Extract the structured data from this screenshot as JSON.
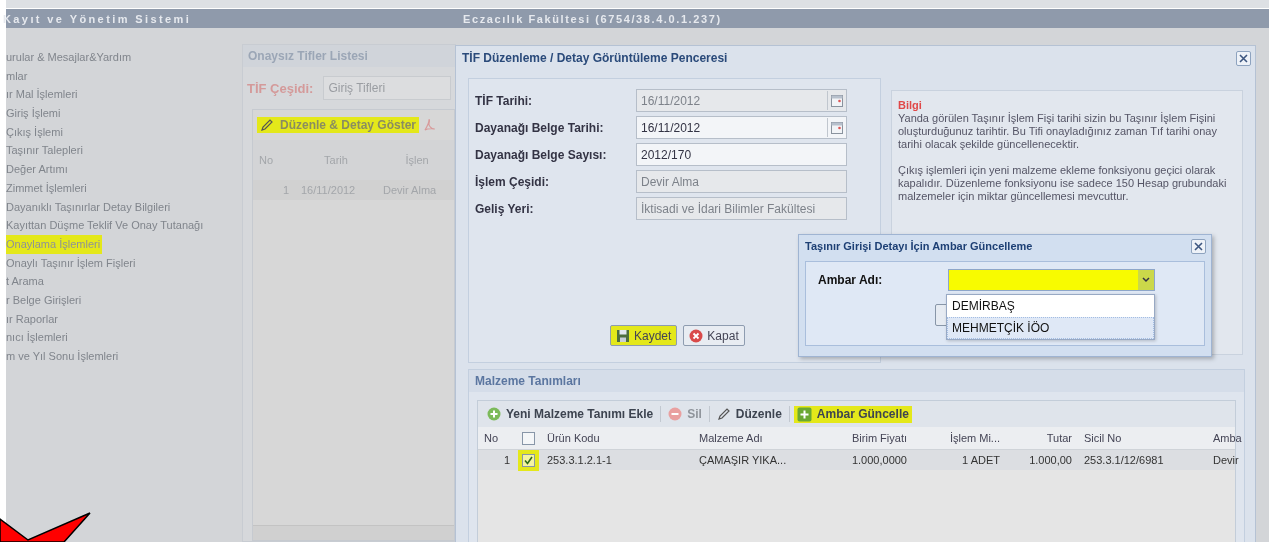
{
  "header": {
    "title": "Kayıt ve Yönetim Sistemi",
    "unit": "Eczacılık Fakültesi (6754/38.4.0.1.237)"
  },
  "sidebar": {
    "items": [
      {
        "label": "urular & Mesajlar&Yardım",
        "highlighted": false
      },
      {
        "label": "mlar",
        "highlighted": false
      },
      {
        "label": "ır Mal İşlemleri",
        "highlighted": false
      },
      {
        "label": "Giriş İşlemi",
        "highlighted": false
      },
      {
        "label": "Çıkış İşlemi",
        "highlighted": false
      },
      {
        "label": "Taşınır Talepleri",
        "highlighted": false
      },
      {
        "label": "Değer Artımı",
        "highlighted": false
      },
      {
        "label": "Zimmet İşlemleri",
        "highlighted": false
      },
      {
        "label": "Dayanıklı Taşınırlar Detay Bilgileri",
        "highlighted": false
      },
      {
        "label": "Kayıttan Düşme Teklif Ve Onay Tutanağı",
        "highlighted": false
      },
      {
        "label": "Onaylama İşlemleri",
        "highlighted": true
      },
      {
        "label": "Onaylı Taşınır İşlem Fişleri",
        "highlighted": false
      },
      {
        "label": "t Arama",
        "highlighted": false
      },
      {
        "label": "r Belge Girişleri",
        "highlighted": false
      },
      {
        "label": "ır Raporlar",
        "highlighted": false
      },
      {
        "label": "nıcı İşlemleri",
        "highlighted": false
      },
      {
        "label": "m ve Yıl Sonu İşlemleri",
        "highlighted": false
      }
    ]
  },
  "list_panel": {
    "title": "Onaysız Tifler Listesi",
    "filter_label": "TİF Çeşidi:",
    "filter_value": "Giriş Tifleri",
    "toolbar": [
      {
        "label": "Düzenle & Detay Göster",
        "highlighted": true
      }
    ],
    "columns": [
      "No",
      "Tarih",
      "İşlen"
    ],
    "rows": [
      [
        "1",
        "16/11/2012",
        "Devir Alma"
      ]
    ]
  },
  "window": {
    "title": "TİF Düzenleme / Detay Görüntüleme Penceresi",
    "fields": [
      {
        "label": "TİF Tarihi:",
        "value": "16/11/2012",
        "kind": "date",
        "disabled": true
      },
      {
        "label": "Dayanağı Belge Tarihi:",
        "value": "16/11/2012",
        "kind": "date",
        "disabled": false
      },
      {
        "label": "Dayanağı Belge Sayısı:",
        "value": "2012/170",
        "kind": "text",
        "disabled": false
      },
      {
        "label": "İşlem Çeşidi:",
        "value": "Devir Alma",
        "kind": "text",
        "disabled": true
      },
      {
        "label": "Geliş Yeri:",
        "value": "İktisadi ve İdari Bilimler Fakültesi",
        "kind": "text",
        "disabled": true
      }
    ],
    "buttons": [
      {
        "label": "Kaydet",
        "kind": "save",
        "highlighted": true
      },
      {
        "label": "Kapat",
        "kind": "close",
        "highlighted": false
      }
    ],
    "info": {
      "title": "Bilgi",
      "paragraphs": [
        "Yanda görülen Taşınır İşlem Fişi tarihi sizin bu Taşınır İşlem Fişini oluşturduğunuz tarihtir. Bu Tifi onayladığınız zaman Tıf tarihi onay tarihi olacak şekilde güncellenecektir.",
        "Çıkış işlemleri için yeni malzeme ekleme fonksiyonu geçici olarak kapalıdır. Düzenleme fonksiyonu ise sadece 150 Hesap grubundaki malzemeler için miktar güncellemesi mevcuttur."
      ]
    },
    "materials": {
      "title": "Malzeme Tanımları",
      "toolbar": [
        {
          "label": "Yeni Malzeme Tanımı Ekle",
          "kind": "add",
          "disabled": false,
          "highlighted": false
        },
        {
          "label": "Sil",
          "kind": "delete",
          "disabled": true,
          "highlighted": false
        },
        {
          "label": "Düzenle",
          "kind": "edit",
          "disabled": false,
          "highlighted": false
        },
        {
          "label": "Ambar Güncelle",
          "kind": "ambar",
          "disabled": false,
          "highlighted": true
        }
      ],
      "select_all_checked": false,
      "columns": [
        "No",
        "Ürün Kodu",
        "Malzeme Adı",
        "Birim Fiyatı",
        "İşlem Mi...",
        "Tutar",
        "Sicil No",
        "Amba"
      ],
      "rows": [
        {
          "checked": true,
          "highlighted": true,
          "cells": [
            "1",
            "253.3.1.2.1-1",
            "ÇAMAŞIR YIKA...",
            "1.000,0000",
            "1  ADET",
            "1.000,00",
            "253.3.1/12/6981",
            "Devir"
          ]
        }
      ]
    }
  },
  "dialog": {
    "title": "Taşınır Girişi Detayı İçin Ambar Güncelleme",
    "label": "Ambar Adı:",
    "highlighted": true,
    "options": [
      {
        "label": "DEMİRBAŞ",
        "selected": false
      },
      {
        "label": "MEHMETÇİK İÖO",
        "selected": true
      }
    ]
  }
}
